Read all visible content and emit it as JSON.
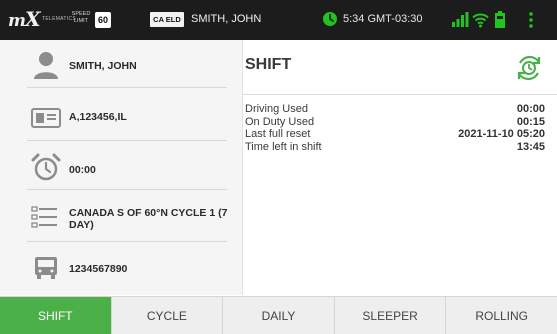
{
  "status_bar": {
    "logo_text": "MiX",
    "telematics_text": "TELEMATICS",
    "speed_label_line1": "SPEED",
    "speed_label_line2": "LIMIT",
    "speed_limit": "60",
    "eld_badge": "CA ELD",
    "driver": "SMITH, JOHN",
    "time": "5:34 GMT-03:30",
    "icons": [
      "clock-icon",
      "signal-icon",
      "wifi-icon",
      "battery-icon",
      "menu-icon"
    ]
  },
  "left_panel": {
    "driver_name": "SMITH, JOHN",
    "license": "A,123456,IL",
    "timer": "00:00",
    "ruleset": "CANADA S OF 60°N CYCLE 1 (7 DAY)",
    "vehicle": "1234567890"
  },
  "main": {
    "title": "SHIFT",
    "stats": [
      {
        "label": "Driving Used",
        "value": "00:00"
      },
      {
        "label": "On Duty Used",
        "value": "00:15"
      },
      {
        "label": "Last full reset",
        "value": "2021-11-10 05:20"
      },
      {
        "label": "Time left in shift",
        "value": "13:45"
      }
    ]
  },
  "tabs": {
    "items": [
      {
        "label": "SHIFT",
        "active": true
      },
      {
        "label": "CYCLE",
        "active": false
      },
      {
        "label": "DAILY",
        "active": false
      },
      {
        "label": "SLEEPER",
        "active": false
      },
      {
        "label": "ROLLING",
        "active": false
      }
    ]
  },
  "colors": {
    "status_bar_bg": "#1c1c1c",
    "accent_green": "#4cb049",
    "bright_green": "#21c31e",
    "panel_bg": "#f5f5f5"
  }
}
